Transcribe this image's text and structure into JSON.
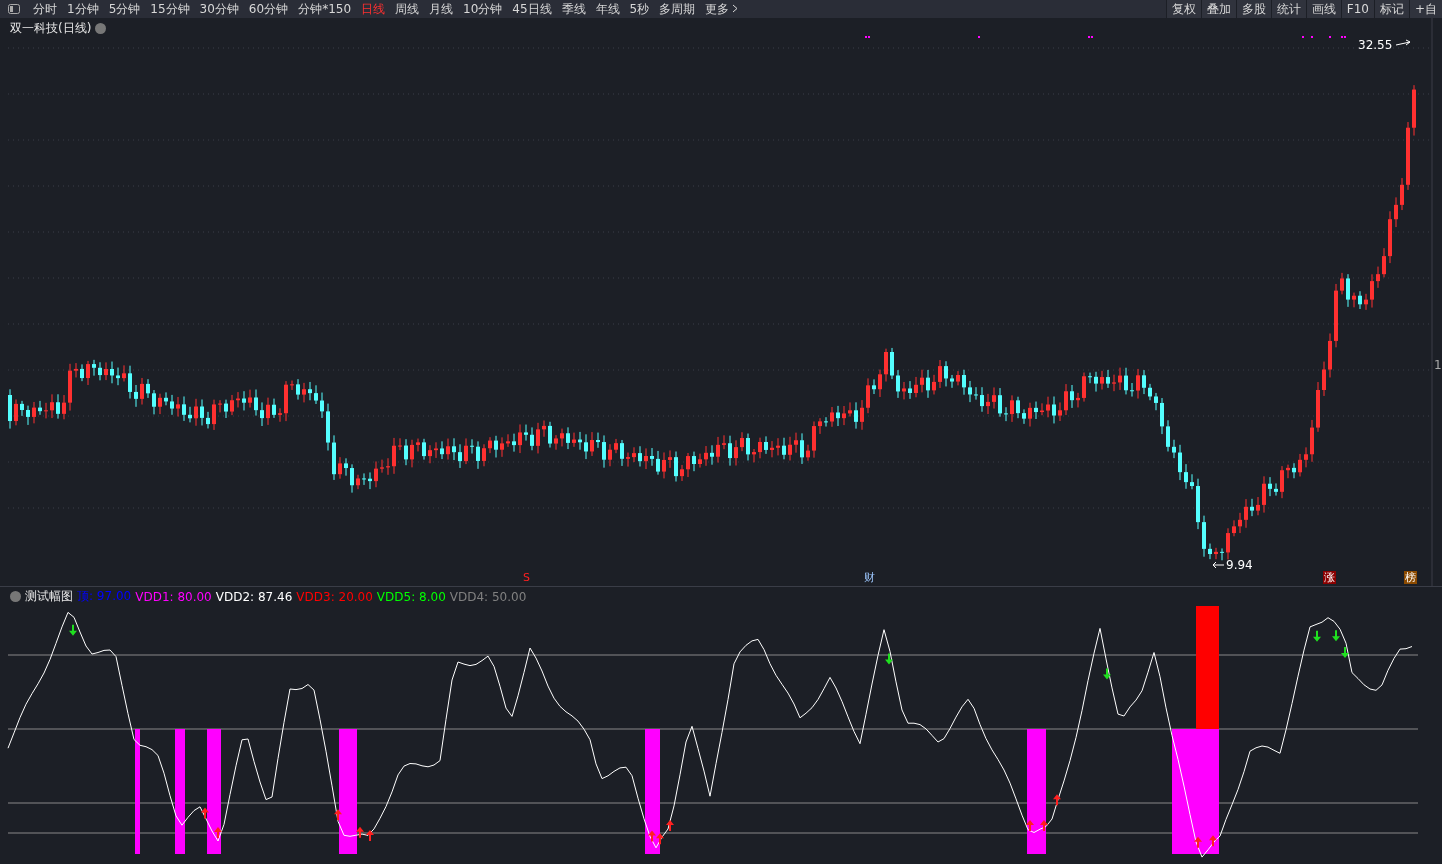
{
  "toolbar": {
    "periods": [
      {
        "label": "分时",
        "selected": false
      },
      {
        "label": "1分钟",
        "selected": false
      },
      {
        "label": "5分钟",
        "selected": false
      },
      {
        "label": "15分钟",
        "selected": false
      },
      {
        "label": "30分钟",
        "selected": false
      },
      {
        "label": "60分钟",
        "selected": false
      },
      {
        "label": "分钟*150",
        "selected": false
      },
      {
        "label": "日线",
        "selected": true
      },
      {
        "label": "周线",
        "selected": false
      },
      {
        "label": "月线",
        "selected": false
      },
      {
        "label": "10分钟",
        "selected": false
      },
      {
        "label": "45日线",
        "selected": false
      },
      {
        "label": "季线",
        "selected": false
      },
      {
        "label": "年线",
        "selected": false
      },
      {
        "label": "5秒",
        "selected": false
      },
      {
        "label": "多周期",
        "selected": false
      }
    ],
    "more": "更多",
    "actions": [
      "复权",
      "叠加",
      "多股",
      "统计",
      "画线",
      "F10",
      "标记",
      "+自"
    ]
  },
  "chart": {
    "title": "双一科技(日线)",
    "high_label": "32.55",
    "low_label": "9.94",
    "axis_label": "1",
    "markers": [
      {
        "text": "S",
        "kind": "signal"
      },
      {
        "text": "财",
        "kind": "finance"
      },
      {
        "text": "涨",
        "kind": "limit"
      },
      {
        "text": "榜",
        "kind": "list"
      }
    ]
  },
  "indicator": {
    "name": "测试幅图",
    "legend": [
      {
        "text": "顶: 97.00",
        "color": "#0000ff"
      },
      {
        "text": "VDD1: 80.00",
        "color": "#ff00ff"
      },
      {
        "text": "VDD2: 87.46",
        "color": "#ffffff"
      },
      {
        "text": "VDD3: 20.00",
        "color": "#ff0000"
      },
      {
        "text": "VDD5: 8.00",
        "color": "#00ff00"
      },
      {
        "text": "VDD4: 50.00",
        "color": "#808080"
      }
    ]
  }
}
